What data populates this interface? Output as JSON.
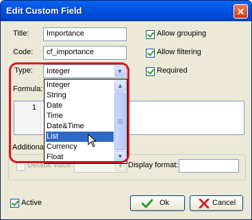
{
  "window": {
    "title": "Edit Custom Field",
    "close_glyph": "✕"
  },
  "fields": {
    "title_label": "Title:",
    "title_value": "Importance",
    "code_label": "Code:",
    "code_value": "cf_importance",
    "type_label": "Type:",
    "type_value": "Integer",
    "formula_label": "Formula:"
  },
  "checkboxes": {
    "allow_grouping": {
      "label": "Allow grouping",
      "checked": true
    },
    "allow_filtering": {
      "label": "Allow filtering",
      "checked": true
    },
    "required": {
      "label": "Required",
      "checked": true
    }
  },
  "type_dropdown": {
    "options": [
      "Integer",
      "String",
      "Date",
      "Time",
      "Date&Time",
      "List",
      "Currency",
      "Float"
    ],
    "selected": "List"
  },
  "formula_editor": {
    "line_number": "1"
  },
  "additional": {
    "group_label": "Additional",
    "default_value_label": "Default value:",
    "display_format_label": "Display format:",
    "display_format_value": ""
  },
  "footer": {
    "active_label": "Active",
    "active_checked": true,
    "ok_label": "Ok",
    "cancel_label": "Cancel"
  },
  "colors": {
    "highlight": "#e3101e",
    "selection": "#316ac5",
    "titlebar": "#0053e1"
  },
  "icons": {
    "ok": "green-checkmark-icon",
    "cancel": "red-x-icon",
    "scroll_up": "chevron-up-icon",
    "scroll_down": "chevron-down-icon",
    "cursor": "mouse-pointer-icon"
  }
}
